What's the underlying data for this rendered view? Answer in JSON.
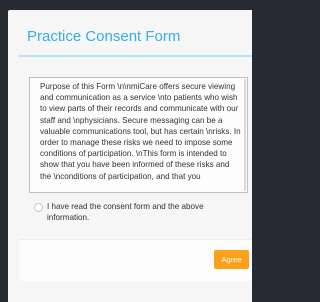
{
  "form": {
    "title": "Practice Consent Form",
    "body_text": "Purpose of this Form \\n\\nmiCare offers secure viewing and communication as a service \\nto patients who wish to view parts of their records and communicate with our staff and \\nphysicians. Secure messaging can be a valuable communications tool, but has certain \\nrisks. In order to manage these risks we need to impose some conditions of participation. \\nThis form is intended to show that you have been informed of these risks and the \\nconditions of participation, and that you",
    "consent_label": "I have read the consent form and the above information.",
    "agree_label": "Agree"
  },
  "colors": {
    "accent": "#36aee8",
    "button": "#f9a11b",
    "backdrop": "#262b33"
  }
}
